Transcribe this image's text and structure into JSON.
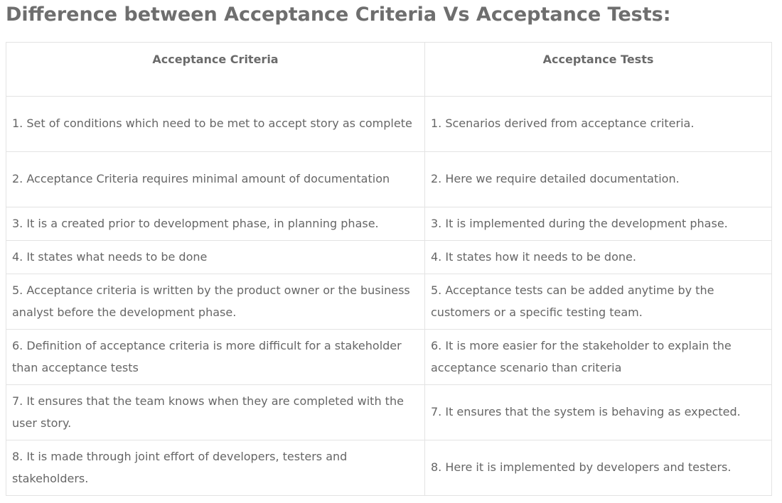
{
  "page": {
    "title": "Difference between Acceptance Criteria Vs Acceptance Tests:"
  },
  "table": {
    "headers": [
      "Acceptance Criteria",
      "Acceptance Tests"
    ],
    "rows": [
      [
        "1. Set of conditions which need to be met to accept story as complete",
        "1. Scenarios derived from acceptance criteria."
      ],
      [
        "2. Acceptance Criteria requires minimal amount of documentation",
        "2. Here we require detailed documentation."
      ],
      [
        "3. It is a created prior to development phase, in planning phase.",
        "3. It is implemented during the development phase."
      ],
      [
        "4.  It states what needs to be done",
        "4. It states how it needs to be done."
      ],
      [
        "5. Acceptance criteria is written by the product owner or the business analyst before the development phase.",
        "5. Acceptance tests can be added anytime by the customers or a specific testing team."
      ],
      [
        "6.  Definition of acceptance criteria is more difficult for a stakeholder than acceptance tests",
        "6. It is more easier for the stakeholder to explain the acceptance scenario than criteria"
      ],
      [
        "7. It ensures that the team knows when they are completed with the user story.",
        "7. It ensures that the system is behaving as expected."
      ],
      [
        "8. It is made through joint effort of developers, testers and stakeholders.",
        "8. Here it is implemented by developers and testers."
      ]
    ]
  }
}
